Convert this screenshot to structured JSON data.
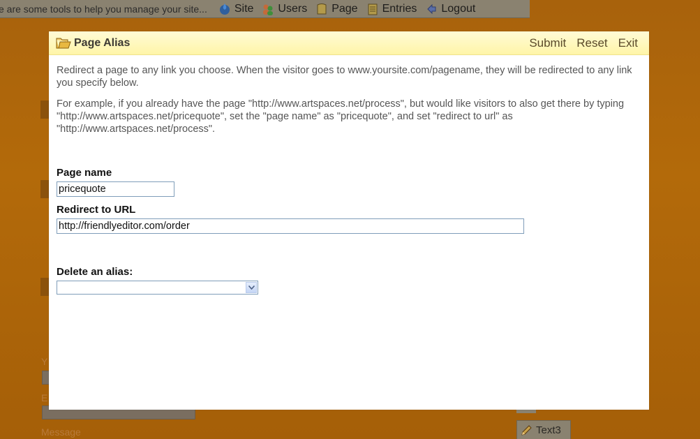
{
  "background": {
    "toolbar_hint": "e are some tools to help you manage your site...",
    "tools": [
      {
        "label": "Site",
        "icon": "globe-icon"
      },
      {
        "label": "Users",
        "icon": "users-icon"
      },
      {
        "label": "Page",
        "icon": "page-icon"
      },
      {
        "label": "Entries",
        "icon": "entries-icon"
      },
      {
        "label": "Logout",
        "icon": "logout-icon"
      }
    ],
    "labels": {
      "message": "Message",
      "y_label": "Y",
      "e_label": "E",
      "text3": "Text3"
    }
  },
  "modal": {
    "title": "Page Alias",
    "title_icon": "folder-icon",
    "actions": {
      "submit": "Submit",
      "reset": "Reset",
      "exit": "Exit"
    },
    "intro": "Redirect a page to any link you choose. When the visitor goes to www.yoursite.com/pagename, they will be redirected to any link you specify below.",
    "example": "For example, if you already have the page \"http://www.artspaces.net/process\", but would like visitors to also get there by typing \"http://www.artspaces.net/pricequote\", set the \"page name\" as \"pricequote\", and set \"redirect to url\" as \"http://www.artspaces.net/process\".",
    "page_name": {
      "label": "Page name",
      "value": "pricequote"
    },
    "redirect_url": {
      "label": "Redirect to URL",
      "value": "http://friendlyeditor.com/order"
    },
    "delete_alias": {
      "label": "Delete an alias:",
      "selected": ""
    }
  },
  "colors": {
    "background_orange": "#a8620c",
    "header_yellow": "#fff5a8",
    "input_border": "#7f9db9"
  }
}
